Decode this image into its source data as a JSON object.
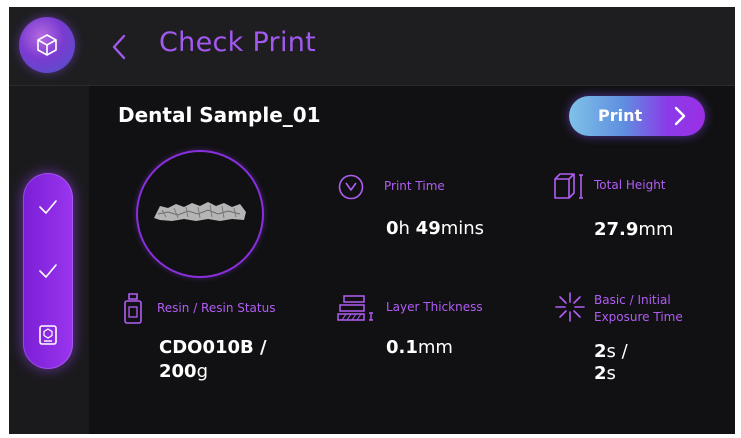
{
  "header": {
    "title": "Check Print"
  },
  "model": {
    "name": "Dental Sample_01"
  },
  "actions": {
    "print_label": "Print"
  },
  "stats": {
    "print_time": {
      "label": "Print Time",
      "hours": "0",
      "hours_unit": "h ",
      "minutes": "49",
      "minutes_unit": "mins"
    },
    "total_height": {
      "label": "Total Height",
      "value": "27.9",
      "unit": "mm"
    },
    "resin": {
      "label": "Resin / Resin Status",
      "code": "CDO010B /",
      "amount": "200",
      "amount_unit": "g"
    },
    "layer_thickness": {
      "label": "Layer Thickness",
      "value": "0.1",
      "unit": "mm"
    },
    "exposure": {
      "label_line1": "Basic / Initial",
      "label_line2": "Exposure Time",
      "basic": "2",
      "basic_unit": "s /",
      "initial": "2",
      "initial_unit": "s"
    }
  },
  "colors": {
    "accent": "#a259f0",
    "rail": "#8a2be2",
    "background": "#111113"
  },
  "icons": [
    "cube-icon",
    "chevron-left-icon",
    "chevron-right-icon",
    "check-icon",
    "document-icon",
    "stopwatch-icon",
    "height-box-icon",
    "resin-bottle-icon",
    "layer-thickness-icon",
    "exposure-burst-icon"
  ]
}
